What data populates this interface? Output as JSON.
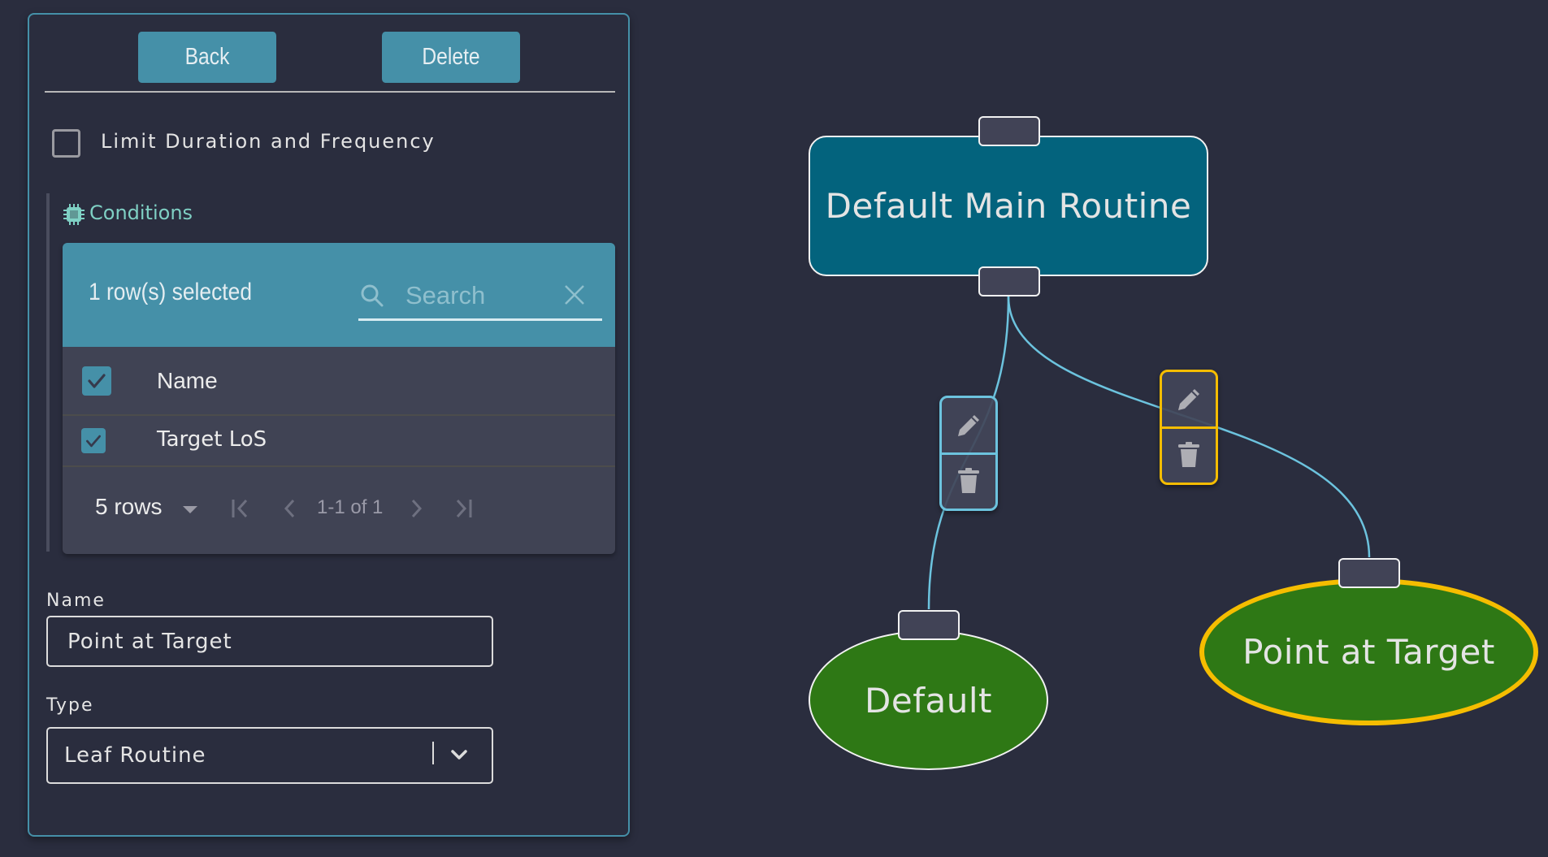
{
  "panel": {
    "buttons": {
      "back": "Back",
      "delete": "Delete"
    },
    "limit_checkbox": {
      "label": "Limit Duration and Frequency",
      "checked": false
    },
    "conditions": {
      "title": "Conditions",
      "icon": "chip-icon",
      "toolbar": {
        "selected_text": "1 row(s) selected",
        "search_placeholder": "Search",
        "search_value": ""
      },
      "columns": [
        "Name"
      ],
      "header_checked": true,
      "rows": [
        {
          "name": "Target LoS",
          "checked": true
        }
      ],
      "pagination": {
        "rows_per_page": "5 rows",
        "range": "1-1 of 1"
      }
    },
    "name_field": {
      "label": "Name",
      "value": "Point at Target"
    },
    "type_field": {
      "label": "Type",
      "value": "Leaf Routine"
    }
  },
  "graph": {
    "nodes": [
      {
        "id": "main",
        "label": "Default Main Routine",
        "shape": "rounded-rect",
        "color": "#03637d"
      },
      {
        "id": "default",
        "label": "Default",
        "shape": "ellipse",
        "color": "#2e7815"
      },
      {
        "id": "point-at-target",
        "label": "Point at Target",
        "shape": "ellipse",
        "color": "#2e7815",
        "selected": true
      }
    ],
    "edges": [
      {
        "from": "main",
        "to": "default",
        "color": "#6cc3de",
        "selected": false
      },
      {
        "from": "main",
        "to": "point-at-target",
        "color": "#6cc3de",
        "selected": true
      }
    ],
    "colors": {
      "accent": "#4590a8",
      "highlight": "#f5bd00",
      "edge": "#6cc3de"
    }
  }
}
